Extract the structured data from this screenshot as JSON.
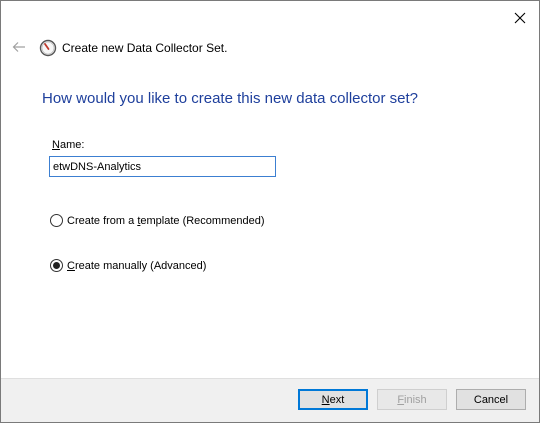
{
  "window": {
    "close_label": "✕"
  },
  "header": {
    "title": "Create new Data Collector Set."
  },
  "main": {
    "heading": "How would you like to create this new data collector set?",
    "name_label_pre": "N",
    "name_label_rest": "ame:",
    "name_value": "etwDNS-Analytics",
    "option_template": {
      "pre": "Create from a ",
      "underline": "t",
      "post": "emplate (Recommended)",
      "checked": false
    },
    "option_manual": {
      "pre": "",
      "underline": "C",
      "post": "reate manually (Advanced)",
      "checked": true
    }
  },
  "footer": {
    "next_underline": "N",
    "next_rest": "ext",
    "finish_underline": "F",
    "finish_rest": "inish",
    "cancel_label": "Cancel"
  }
}
